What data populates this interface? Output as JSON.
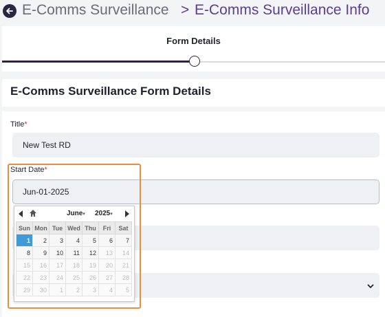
{
  "breadcrumb": {
    "root": "E-Comms Surveillance",
    "separator": ">",
    "current": "E-Comms Surveillance Info"
  },
  "stepper": {
    "label": "Form Details",
    "progress": 0.5
  },
  "section": {
    "title": "E-Comms Surveillance Form Details"
  },
  "form": {
    "title_label": "Title",
    "title_value": "New Test RD",
    "start_date_label": "Start Date",
    "start_date_value": "Jun-01-2025",
    "required_mark": "*"
  },
  "calendar": {
    "month": "June",
    "year": "2025",
    "weekdays": [
      "Sun",
      "Mon",
      "Tue",
      "Wed",
      "Thu",
      "Fri",
      "Sat"
    ],
    "weeks": [
      [
        "1",
        "2",
        "3",
        "4",
        "5",
        "6",
        "7"
      ],
      [
        "8",
        "9",
        "10",
        "11",
        "12",
        "13",
        "14"
      ],
      [
        "15",
        "16",
        "17",
        "18",
        "19",
        "20",
        "21"
      ],
      [
        "22",
        "23",
        "24",
        "25",
        "26",
        "27",
        "28"
      ],
      [
        "29",
        "30",
        "1",
        "2",
        "3",
        "4",
        "5"
      ]
    ],
    "selected_day": "1"
  },
  "icons": {
    "back": "arrow-left-icon",
    "prev": "triangle-left-icon",
    "today": "home-icon",
    "next": "triangle-right-icon",
    "select": "chevron-down-icon"
  },
  "colors": {
    "accent": "#5b3f8f",
    "dark": "#2e2240",
    "focus_outline": "#f08a3c",
    "selected_day": "#3f9ad8",
    "required": "#d0352b"
  }
}
